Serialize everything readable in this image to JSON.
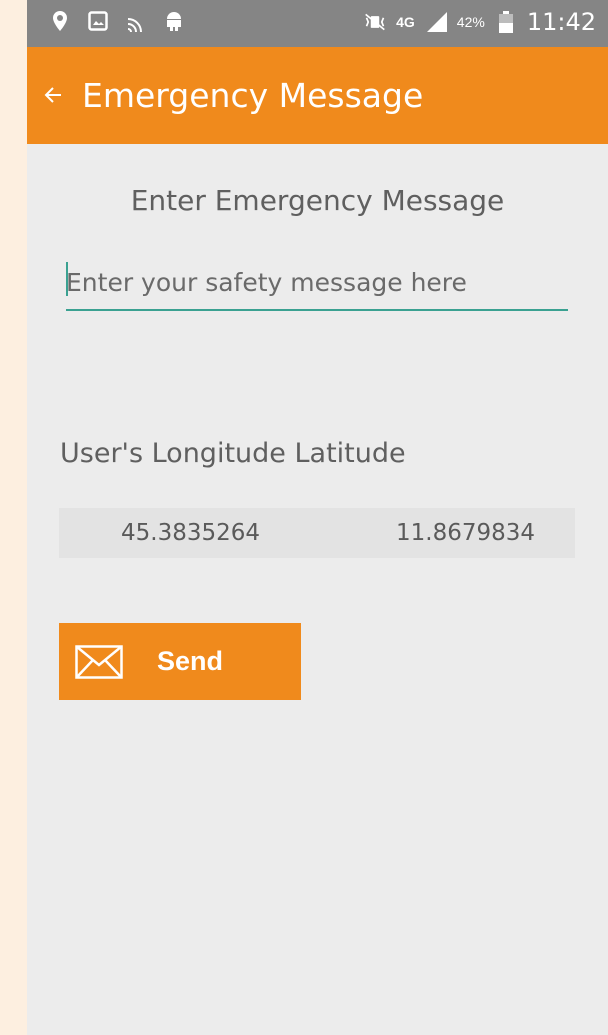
{
  "status_bar": {
    "icons": [
      "location-icon",
      "image-icon",
      "cast-icon",
      "android-icon",
      "vibrate-icon",
      "signal-icon",
      "battery-icon"
    ],
    "network": "4G",
    "battery": "42%",
    "time": "11:42"
  },
  "app_bar": {
    "title": "Emergency Message",
    "back_icon": "arrow-left-icon",
    "color": "#f08a1c"
  },
  "form": {
    "heading": "Enter Emergency Message",
    "message_input": {
      "value": "",
      "placeholder": "Enter your safety message here"
    }
  },
  "location": {
    "label": "User's Longitude Latitude",
    "longitude": "45.3835264",
    "latitude": "11.8679834"
  },
  "send_button": {
    "label": "Send",
    "icon": "envelope-icon"
  }
}
